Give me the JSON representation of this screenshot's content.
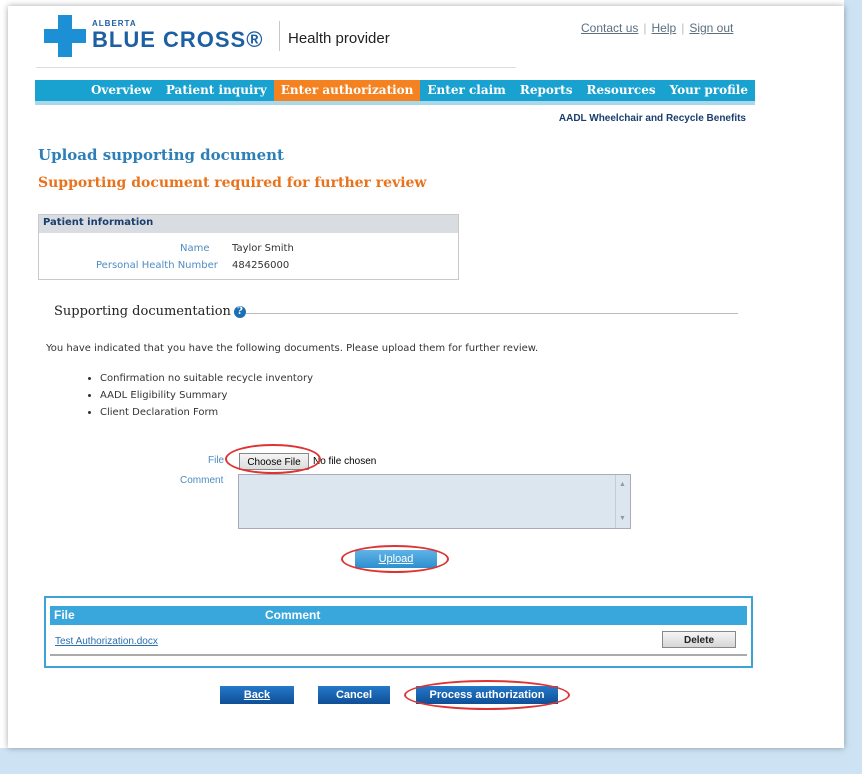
{
  "header": {
    "brand_small": "ALBERTA",
    "brand_big": "BLUE CROSS®",
    "app_name": "Health provider",
    "links": [
      "Contact us",
      "Help",
      "Sign out"
    ]
  },
  "nav": {
    "items": [
      "Overview",
      "Patient inquiry",
      "Enter authorization",
      "Enter claim",
      "Reports",
      "Resources",
      "Your profile"
    ],
    "active": "Enter authorization",
    "subtitle": "AADL Wheelchair and Recycle Benefits"
  },
  "page": {
    "title": "Upload supporting document",
    "subtitle": "Supporting document required for further review"
  },
  "patient": {
    "header": "Patient information",
    "name_label": "Name",
    "name_value": "Taylor Smith",
    "phn_label": "Personal Health Number",
    "phn_value": "484256000"
  },
  "docs": {
    "section_title": "Supporting documentation",
    "intro": "You have indicated that you have the following documents. Please upload them for further review.",
    "items": [
      "Confirmation no suitable recycle inventory",
      "AADL Eligibility Summary",
      "Client Declaration Form"
    ]
  },
  "upload": {
    "file_label": "File",
    "choose_button": "Choose File",
    "no_file_text": "No file chosen",
    "comment_label": "Comment",
    "upload_button": "Upload"
  },
  "files_table": {
    "col_file": "File",
    "col_comment": "Comment",
    "rows": [
      {
        "file": "Test Authorization.docx",
        "comment": ""
      }
    ],
    "delete_button": "Delete"
  },
  "actions": {
    "back": "Back",
    "cancel": "Cancel",
    "process": "Process authorization"
  },
  "colors": {
    "nav_bg": "#19a1d0",
    "nav_active": "#f58220",
    "title_blue": "#2d7fb8",
    "subtitle_orange": "#e8731c",
    "highlight_red": "#dd3333"
  }
}
